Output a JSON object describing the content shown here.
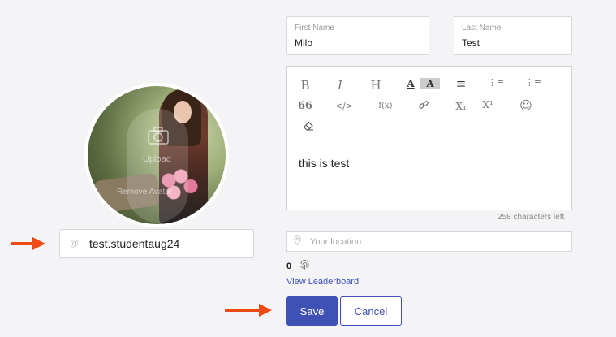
{
  "profile": {
    "username": "test.studentaug24",
    "username_icon": "at-icon",
    "avatar_upload_label": "Upload",
    "avatar_remove_label": "Remove Avatar"
  },
  "name": {
    "first_label": "First Name",
    "first_value": "Milo",
    "last_label": "Last Name",
    "last_value": "Test"
  },
  "editor": {
    "toolbar": {
      "bold": "B",
      "italic": "I",
      "heading": "H",
      "font_color": "A",
      "highlight": "A",
      "align": "≡",
      "ordered_list": "⋮≡",
      "bullet_list": "⋮≡",
      "quote": "66",
      "code": "</>",
      "formula": "f(x)",
      "link": "🔗",
      "subscript": "X₁",
      "superscript": "X¹",
      "emoji": "☺",
      "eraser": "⌫"
    },
    "content": "this is test",
    "chars_left": "258 characters left"
  },
  "location": {
    "placeholder": "Your location",
    "value": ""
  },
  "points": {
    "value": "0"
  },
  "leaderboard_link": "View Leaderboard",
  "actions": {
    "save_label": "Save",
    "cancel_label": "Cancel"
  },
  "colors": {
    "accent": "#3f51b5",
    "arrow": "#f04a14",
    "background": "#f4f4f6"
  }
}
